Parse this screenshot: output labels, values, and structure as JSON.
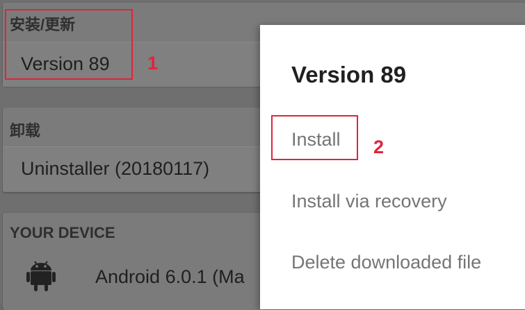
{
  "sections": {
    "install": {
      "title": "安装/更新",
      "item": "Version 89"
    },
    "uninstall": {
      "title": "卸载",
      "item": "Uninstaller (20180117)"
    },
    "device": {
      "title": "YOUR DEVICE",
      "item": "Android 6.0.1 (Ma",
      "icon": "android-icon"
    }
  },
  "dialog": {
    "title": "Version 89",
    "options": [
      "Install",
      "Install via recovery",
      "Delete downloaded file"
    ]
  },
  "annotations": {
    "marker_1": "1",
    "marker_2": "2",
    "highlight_color": "#e0243a"
  }
}
